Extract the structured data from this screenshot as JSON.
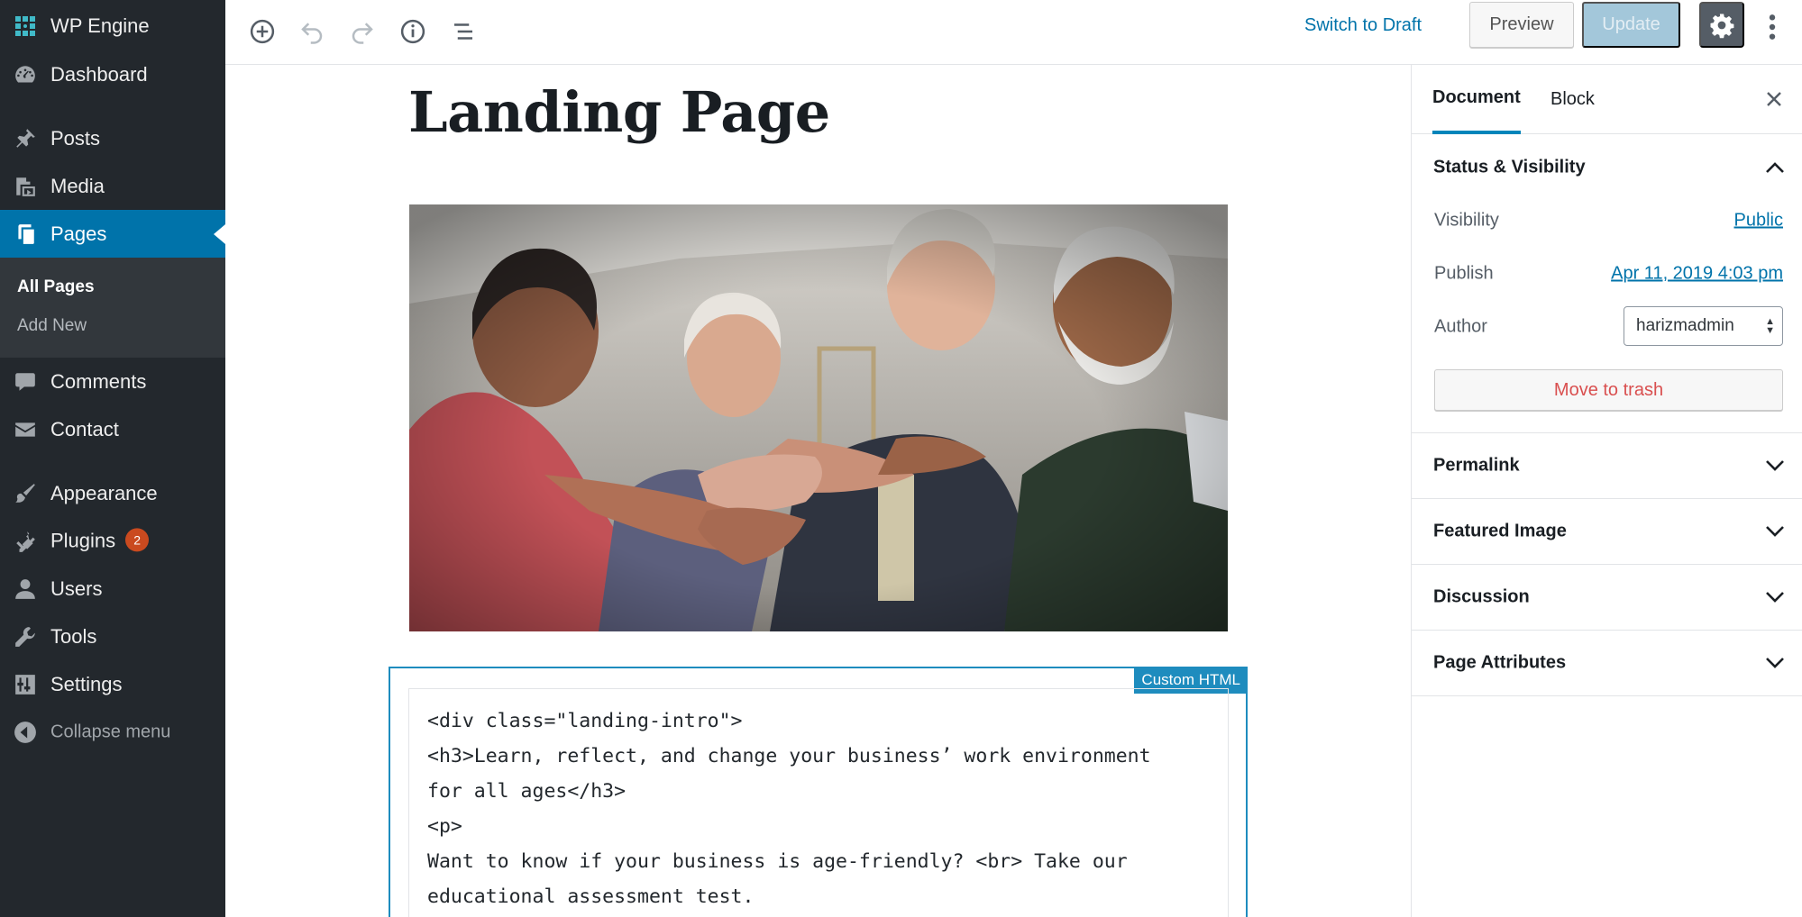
{
  "admin_menu": {
    "site_name": "WP Engine",
    "items": [
      {
        "label": "Dashboard",
        "icon": "dashboard-icon"
      },
      {
        "label": "Posts",
        "icon": "pin-icon"
      },
      {
        "label": "Media",
        "icon": "media-icon"
      },
      {
        "label": "Pages",
        "icon": "pages-icon",
        "current": true
      },
      {
        "label": "Comments",
        "icon": "comment-icon"
      },
      {
        "label": "Contact",
        "icon": "envelope-icon"
      },
      {
        "label": "Appearance",
        "icon": "paintbrush-icon"
      },
      {
        "label": "Plugins",
        "icon": "plugin-icon",
        "badge": "2"
      },
      {
        "label": "Users",
        "icon": "user-icon"
      },
      {
        "label": "Tools",
        "icon": "wrench-icon"
      },
      {
        "label": "Settings",
        "icon": "sliders-icon"
      }
    ],
    "submenu": {
      "all_pages": "All Pages",
      "add_new": "Add New"
    },
    "collapse_label": "Collapse menu"
  },
  "toolbar": {
    "switch_to_draft": "Switch to Draft",
    "preview": "Preview",
    "update": "Update"
  },
  "editor": {
    "title": "Landing Page",
    "custom_html_label": "Custom HTML",
    "code_lines": [
      "<div class=\"landing-intro\">",
      "<h3>Learn, reflect, and change your business’ work environment",
      "for all ages</h3>",
      "<p>",
      "Want to know if your business is age-friendly? <br> Take our",
      "educational assessment test."
    ]
  },
  "sidebar": {
    "tab_document": "Document",
    "tab_block": "Block",
    "status_visibility": {
      "title": "Status & Visibility",
      "visibility_label": "Visibility",
      "visibility_value": "Public",
      "publish_label": "Publish",
      "publish_value": "Apr 11, 2019 4:03 pm",
      "author_label": "Author",
      "author_value": "harizmadmin",
      "move_to_trash": "Move to trash"
    },
    "panels": [
      "Permalink",
      "Featured Image",
      "Discussion",
      "Page Attributes"
    ]
  },
  "colors": {
    "admin_bg": "#23282d",
    "submenu_bg": "#32373c",
    "accent": "#0073aa",
    "badge": "#ca4a1f",
    "trash_text": "#d94f4f",
    "update_disabled": "#a3c7da"
  }
}
